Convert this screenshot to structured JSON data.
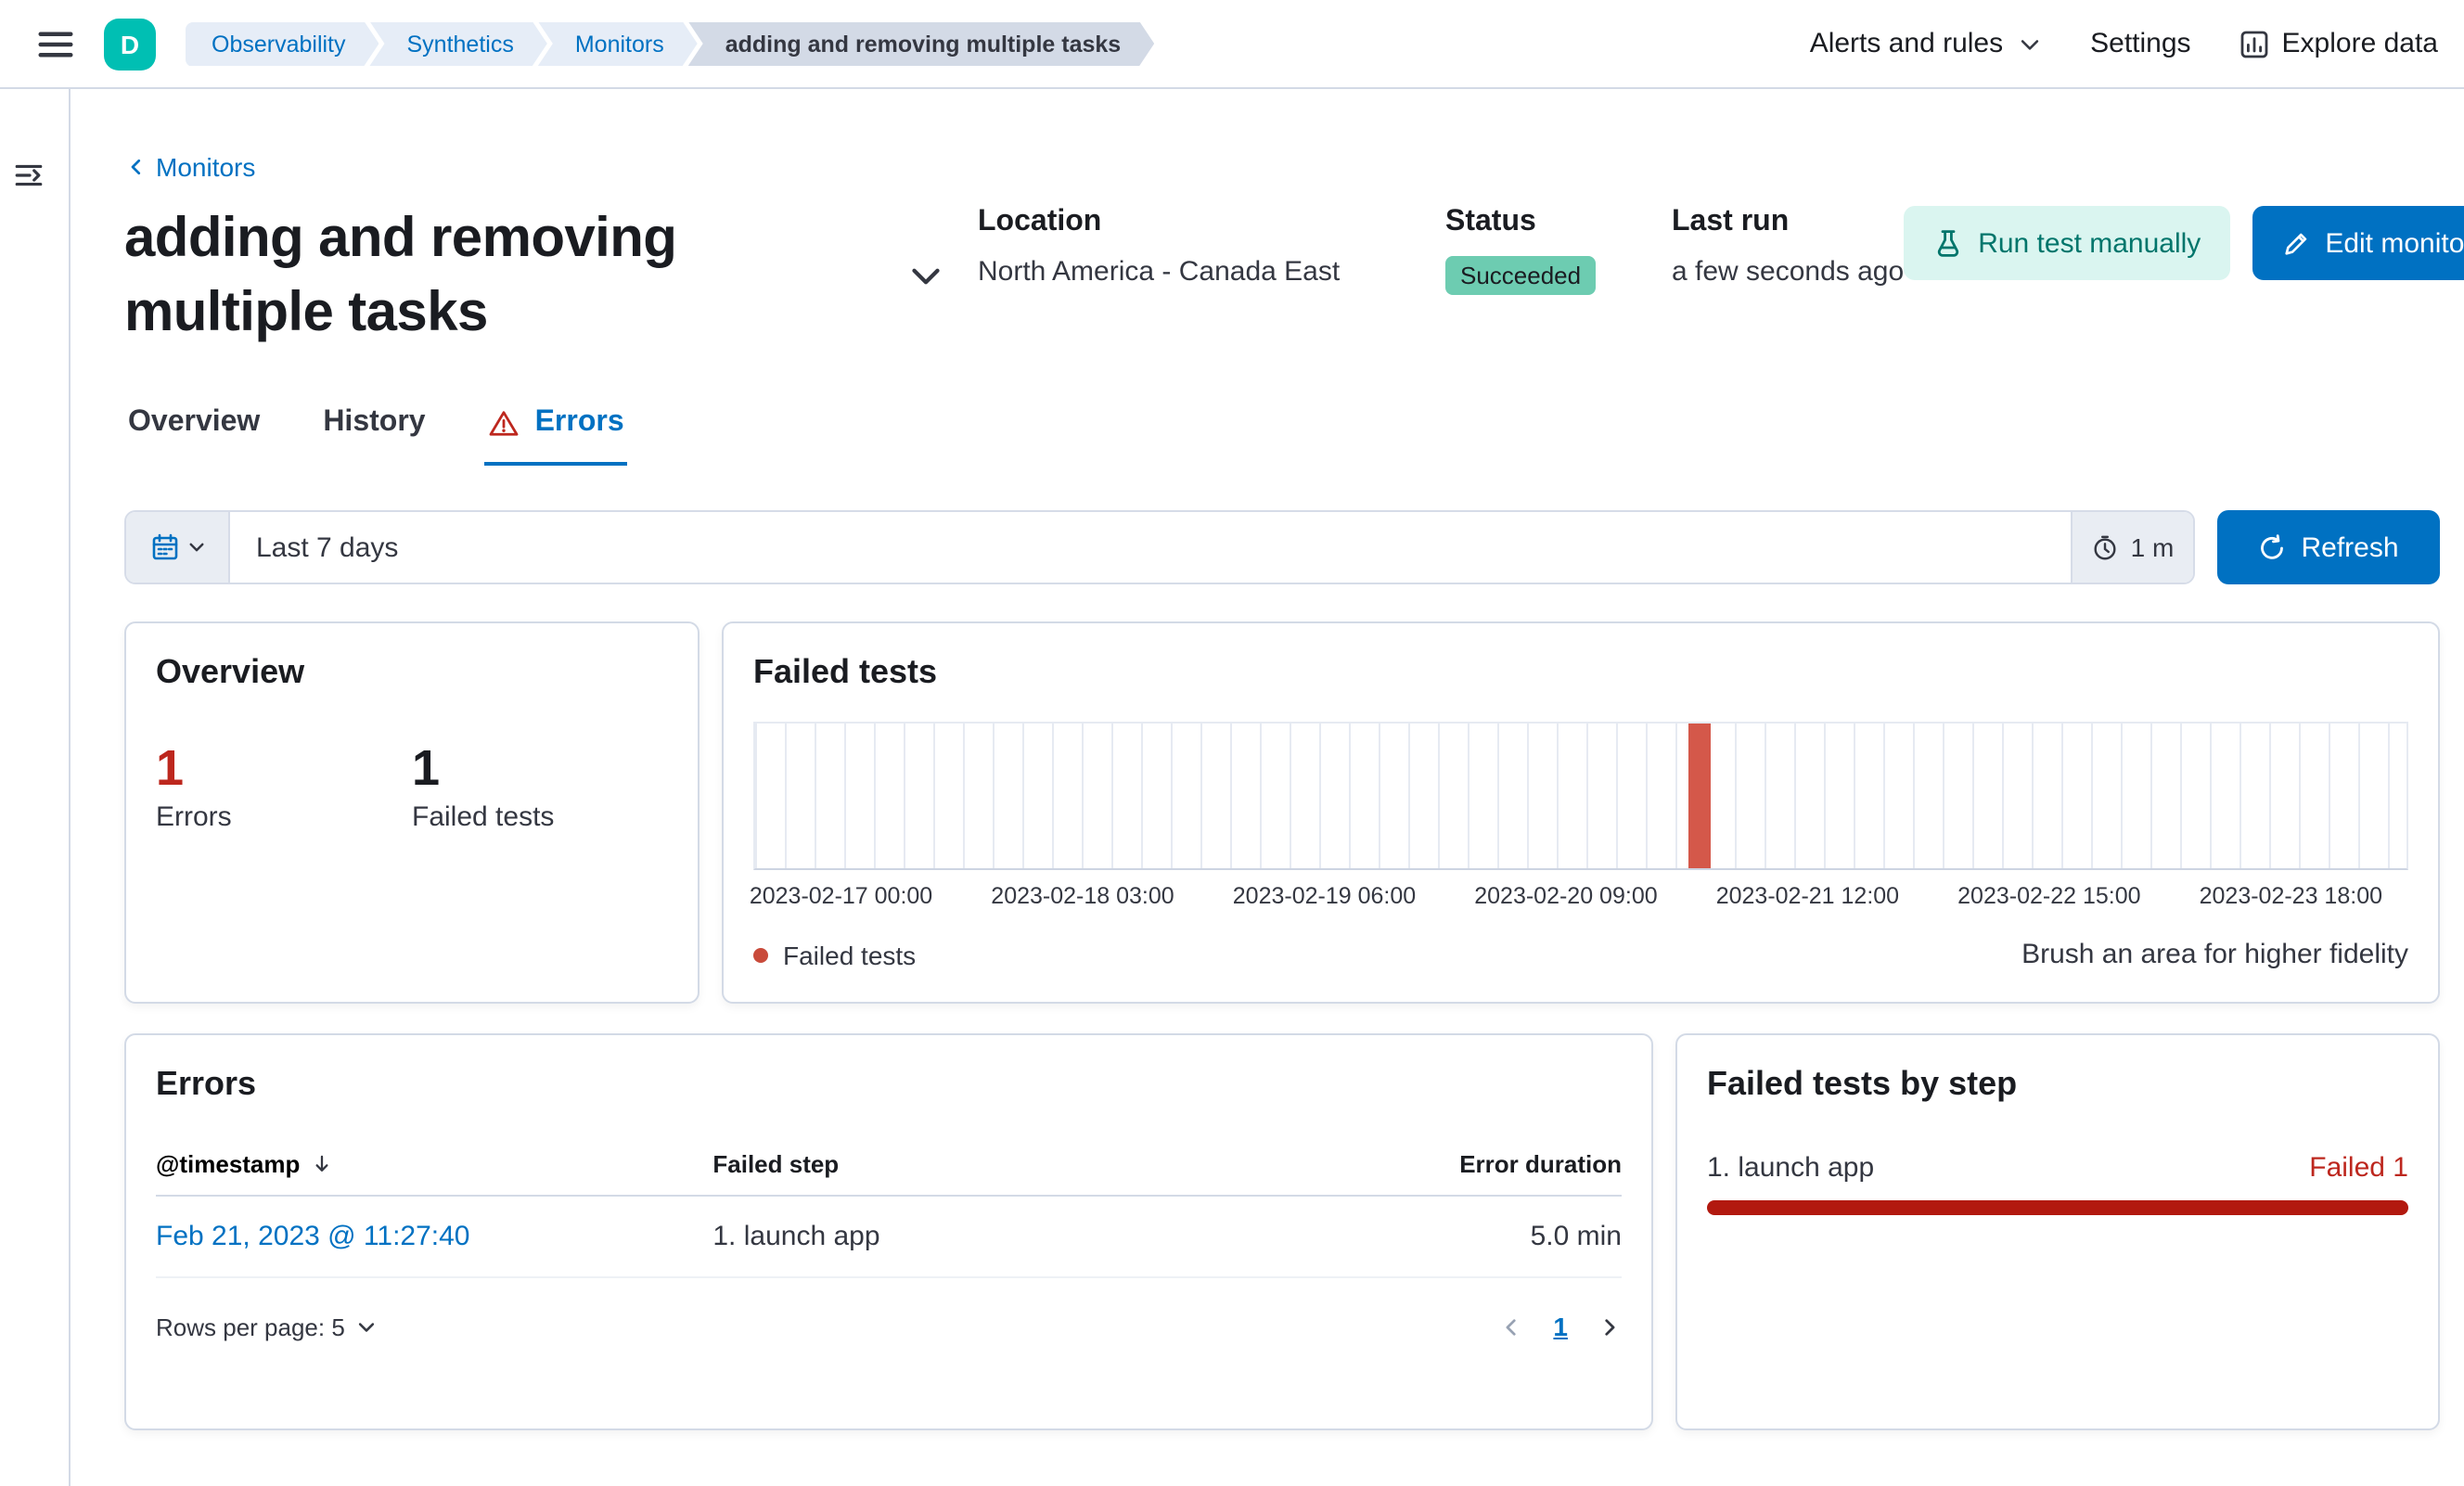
{
  "header": {
    "avatar_initial": "D",
    "breadcrumbs": [
      "Observability",
      "Synthetics",
      "Monitors",
      "adding and removing multiple tasks"
    ],
    "nav": {
      "alerts_label": "Alerts and rules",
      "settings_label": "Settings",
      "explore_label": "Explore data"
    }
  },
  "page": {
    "back_label": "Monitors",
    "title": "adding and removing multiple tasks",
    "meta": {
      "location_label": "Location",
      "location_value": "North America - Canada East",
      "status_label": "Status",
      "status_value": "Succeeded",
      "last_run_label": "Last run",
      "last_run_value": "a few seconds ago"
    },
    "actions": {
      "run_test": "Run test manually",
      "edit": "Edit monitor"
    },
    "tabs": [
      "Overview",
      "History",
      "Errors"
    ]
  },
  "filter": {
    "range": "Last 7 days",
    "interval": "1 m",
    "refresh_label": "Refresh"
  },
  "overview_card": {
    "title": "Overview",
    "errors_count": "1",
    "errors_label": "Errors",
    "failed_count": "1",
    "failed_label": "Failed tests"
  },
  "failed_tests_card": {
    "title": "Failed tests",
    "legend_label": "Failed tests",
    "brush_hint": "Brush an area for higher fidelity"
  },
  "chart_data": {
    "type": "bar",
    "title": "Failed tests",
    "x_tick_labels": [
      "2023-02-17 00:00",
      "2023-02-18 03:00",
      "2023-02-19 06:00",
      "2023-02-20 09:00",
      "2023-02-21 12:00",
      "2023-02-22 15:00",
      "2023-02-23 18:00"
    ],
    "series": [
      {
        "name": "Failed tests",
        "color": "#d4584a",
        "points": [
          {
            "x": "2023-02-21 ~01:00",
            "y": 1
          }
        ]
      }
    ],
    "ylim": [
      0,
      1
    ],
    "grid": "vertical-columns",
    "legend_position": "bottom-left",
    "annotations": [
      "Brush an area for higher fidelity"
    ],
    "bar_position": {
      "left_pct": 56.5,
      "width_pct": 1.35
    }
  },
  "errors_card": {
    "title": "Errors",
    "columns": [
      "@timestamp",
      "Failed step",
      "Error duration"
    ],
    "rows": [
      {
        "timestamp": "Feb 21, 2023 @ 11:27:40",
        "failed_step": "1. launch app",
        "error_duration": "5.0 min"
      }
    ],
    "rows_per_page": "Rows per page: 5",
    "page": "1"
  },
  "failed_steps_card": {
    "title": "Failed tests by step",
    "steps": [
      {
        "label": "1. launch app",
        "badge": "Failed 1",
        "value": 1,
        "max": 1
      }
    ]
  },
  "colors": {
    "accent_blue": "#0071c2",
    "danger_text": "#bd271e",
    "chart_bar": "#d4584a",
    "step_bar": "#b2190f",
    "success_badge": "#6dccb1",
    "avatar_teal": "#00bfb3"
  }
}
